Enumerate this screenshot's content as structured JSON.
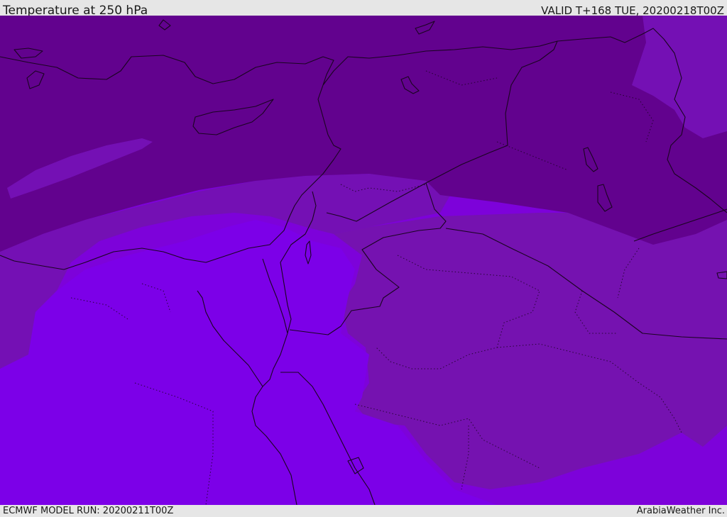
{
  "header": {
    "title": "Temperature at 250 hPa",
    "valid": "VALID T+168 TUE, 20200218T00Z"
  },
  "footer": {
    "model_run": "ECMWF MODEL RUN: 20200211T00Z",
    "provider": "ArabiaWeather Inc."
  },
  "colors": {
    "band_darkest": "#62028e",
    "band_dark": "#7510ac",
    "band_mid": "#7e02d7",
    "band_light": "#7702de",
    "band_bright": "#7a00f2",
    "coastline": "#1a0420"
  }
}
